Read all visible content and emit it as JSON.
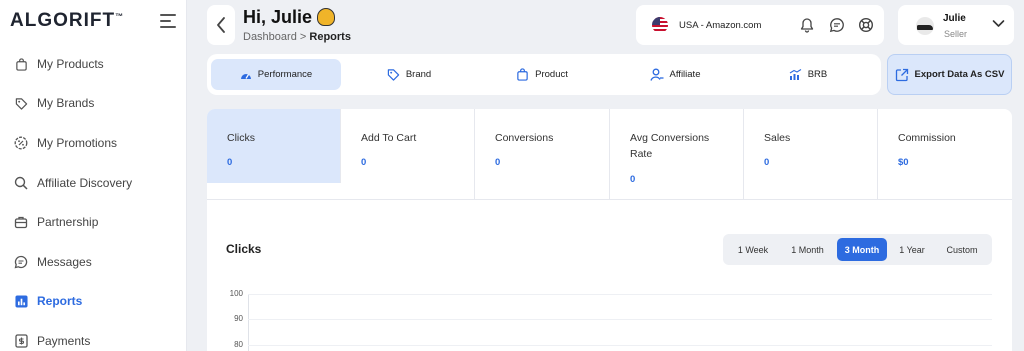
{
  "brand": {
    "logo_text": "ALGORIFT",
    "logo_mark": "™"
  },
  "sidebar": {
    "items": [
      {
        "label": "My Products",
        "icon": "bag-icon"
      },
      {
        "label": "My Brands",
        "icon": "tag-icon"
      },
      {
        "label": "My Promotions",
        "icon": "promotion-icon"
      },
      {
        "label": "Affiliate Discovery",
        "icon": "search-icon"
      },
      {
        "label": "Partnership",
        "icon": "briefcase-icon"
      },
      {
        "label": "Messages",
        "icon": "chat-icon"
      },
      {
        "label": "Reports",
        "icon": "reports-icon",
        "active": true
      },
      {
        "label": "Payments",
        "icon": "payments-icon"
      }
    ]
  },
  "header": {
    "greeting": "Hi, Julie",
    "breadcrumb_parent": "Dashboard",
    "breadcrumb_separator": ">",
    "breadcrumb_current": "Reports",
    "store": "USA - Amazon.com",
    "user_name": "Julie",
    "user_role": "Seller"
  },
  "tabs": [
    {
      "label": "Performance",
      "icon": "gauge-icon",
      "active": true
    },
    {
      "label": "Brand",
      "icon": "tag-icon"
    },
    {
      "label": "Product",
      "icon": "bag-icon"
    },
    {
      "label": "Affiliate",
      "icon": "user-icon"
    },
    {
      "label": "BRB",
      "icon": "chart-icon"
    }
  ],
  "export_label": "Export Data As CSV",
  "stats": [
    {
      "label": "Clicks",
      "value": "0",
      "active": true
    },
    {
      "label": "Add To Cart",
      "value": "0"
    },
    {
      "label": "Conversions",
      "value": "0"
    },
    {
      "label": "Avg Conversions Rate",
      "value": "0"
    },
    {
      "label": "Sales",
      "value": "0"
    },
    {
      "label": "Commission",
      "value": "$0"
    }
  ],
  "chart": {
    "title": "Clicks",
    "ranges": [
      "1 Week",
      "1 Month",
      "3 Month",
      "1 Year",
      "Custom"
    ],
    "active_range": "3 Month",
    "y_ticks": [
      "100",
      "90",
      "80"
    ]
  },
  "colors": {
    "accent": "#2d6be0",
    "accent_light": "#dbe7fb",
    "background": "#eef0f4"
  }
}
